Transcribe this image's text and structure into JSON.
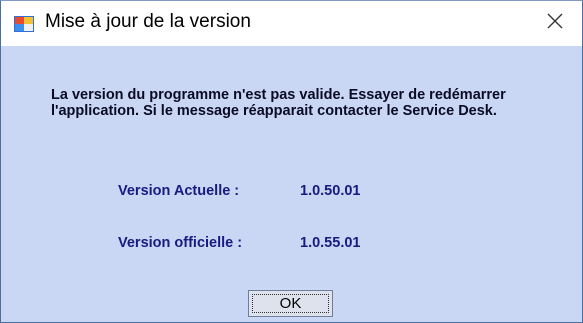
{
  "window": {
    "title": "Mise à jour de la version"
  },
  "dialog": {
    "message": "La version du programme n'est pas valide. Essayer de redémarrer l'application. Si le message réapparait contacter le Service Desk.",
    "current_version_label": "Version Actuelle :",
    "current_version_value": "1.0.50.01",
    "official_version_label": "Version officielle :",
    "official_version_value": "1.0.55.01",
    "ok_label": "OK"
  },
  "icons": {
    "app": "app-window-icon",
    "close": "close-icon"
  },
  "colors": {
    "client_background": "#c9d7f5",
    "version_text": "#1a1a80"
  }
}
